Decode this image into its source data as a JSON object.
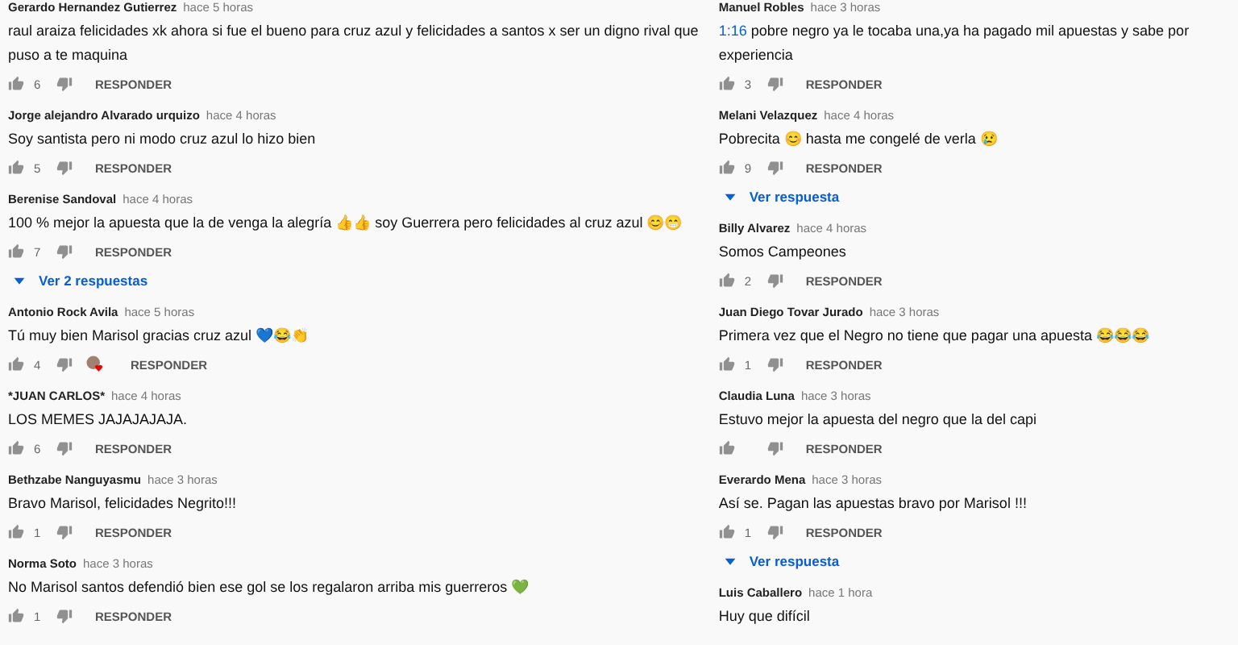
{
  "columns": [
    {
      "comments": [
        {
          "author": "Gerardo Hernandez Gutierrez",
          "time": "hace 5 horas",
          "text": "raul araiza felicidades xk ahora si fue el bueno para cruz azul y felicidades a santos x ser un digno rival que puso a te maquina",
          "likes": "6",
          "reply": "RESPONDER"
        },
        {
          "author": "Jorge alejandro Alvarado urquizo",
          "time": "hace 4 horas",
          "text": "Soy santista pero ni modo cruz azul lo hizo bien",
          "likes": "5",
          "reply": "RESPONDER"
        },
        {
          "author": "Berenise Sandoval",
          "time": "hace 4 horas",
          "text": "100 % mejor la apuesta que la de venga la alegría 👍👍 soy Guerrera  pero felicidades al cruz azul 😊😁",
          "likes": "7",
          "reply": "RESPONDER",
          "replies": "Ver 2 respuestas"
        },
        {
          "author": "Antonio Rock Avila",
          "time": "hace 5 horas",
          "text": "Tú muy bien Marisol gracias cruz azul 💙😂👏",
          "likes": "4",
          "hearted": true,
          "reply": "RESPONDER"
        },
        {
          "author": "*JUAN CARLOS*",
          "time": "hace 4 horas",
          "text": "LOS MEMES JAJAJAJAJA.",
          "likes": "6",
          "reply": "RESPONDER"
        },
        {
          "author": "Bethzabe Nanguyasmu",
          "time": "hace 3 horas",
          "text": "Bravo Marisol, felicidades Negrito!!!",
          "likes": "1",
          "reply": "RESPONDER"
        },
        {
          "author": "Norma Soto",
          "time": "hace 3 horas",
          "text": "No Marisol santos defendió bien ese gol se los regalaron arriba mis guerreros 💚",
          "likes": "1",
          "reply": "RESPONDER"
        }
      ]
    },
    {
      "comments": [
        {
          "author": "Manuel Robles",
          "time": "hace 3 horas",
          "link": "1:16",
          "text": " pobre negro ya le tocaba una,ya ha pagado mil apuestas y sabe por experiencia",
          "likes": "3",
          "reply": "RESPONDER"
        },
        {
          "author": "Melani Velazquez",
          "time": "hace 4 horas",
          "text": "Pobrecita 😊 hasta me congelé de verla 😢",
          "likes": "9",
          "reply": "RESPONDER",
          "replies": "Ver respuesta"
        },
        {
          "author": "Billy Alvarez",
          "time": "hace 4 horas",
          "text": "Somos Campeones",
          "likes": "2",
          "reply": "RESPONDER"
        },
        {
          "author": "Juan Diego Tovar Jurado",
          "time": "hace 3 horas",
          "text": "Primera vez que el Negro no tiene que pagar una apuesta 😂😂😂",
          "likes": "1",
          "reply": "RESPONDER"
        },
        {
          "author": "Claudia Luna",
          "time": "hace 3 horas",
          "text": "Estuvo mejor la apuesta del negro que la del capi",
          "reply": "RESPONDER"
        },
        {
          "author": "Everardo Mena",
          "time": "hace 3 horas",
          "text": "Así se. Pagan las apuestas bravo por Marisol !!!",
          "likes": "1",
          "reply": "RESPONDER",
          "replies": "Ver respuesta"
        },
        {
          "author": "Luis Caballero",
          "time": "hace 1 hora",
          "text": "Huy que difícil"
        }
      ]
    }
  ]
}
